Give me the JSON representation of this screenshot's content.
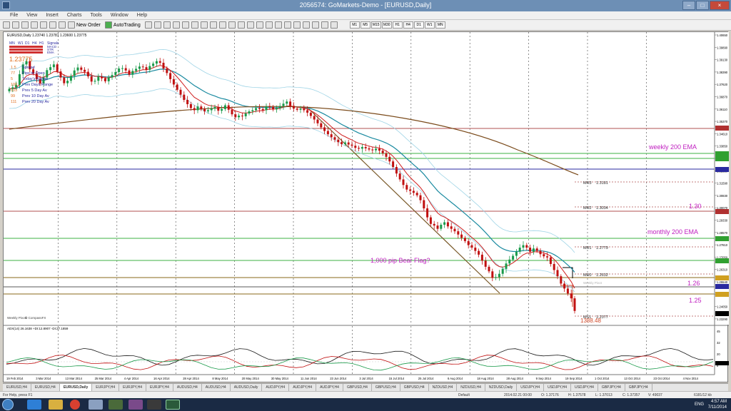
{
  "window": {
    "title": "2056574: GoMarkets-Demo - [EURUSD,Daily]"
  },
  "menu": [
    "File",
    "View",
    "Insert",
    "Charts",
    "Tools",
    "Window",
    "Help"
  ],
  "toolbar": {
    "new_order": "New Order",
    "autotrading": "AutoTrading",
    "timeframes": [
      "M1",
      "M5",
      "M15",
      "M30",
      "H1",
      "H4",
      "D1",
      "W1",
      "MN"
    ]
  },
  "chart_header": "EURUSD,Daily  1.23740 1.23781 1.23600 1.23775",
  "panel": {
    "tf_labels": [
      "MN",
      "W1",
      "D1",
      "H4",
      "H1"
    ],
    "signals_label": "Signals",
    "legend": [
      "MACD",
      "STR",
      "EMA"
    ],
    "price": "1.23775",
    "rows": [
      {
        "val": "1.5",
        "label": "Spread"
      },
      {
        "val": "77",
        "label": "Pips to Open"
      },
      {
        "val": "5",
        "label": "Today's Range"
      },
      {
        "val": "100",
        "label": "Prev Days Range"
      },
      {
        "val": "103",
        "label": "Prev 5 Day Av"
      },
      {
        "val": "99",
        "label": "Prev 10 Day Av"
      },
      {
        "val": "111",
        "label": "Prev 20 Day Av"
      }
    ]
  },
  "annotations": {
    "weekly": "weekly 200 EMA",
    "l130": "1.30",
    "monthly": "monthly 200 EMA",
    "flag": "1,000 pip Bear Flag?",
    "l126": "1.26",
    "l125": "1.25",
    "weekly_pivots": "Weekly Pivots",
    "copyright": "© CompassFX",
    "weekly_pivot_label": "Weekly Pivot"
  },
  "pivots": [
    {
      "name": "MR3",
      "value": "1.3181"
    },
    {
      "name": "MR2",
      "value": "1.3034"
    },
    {
      "name": "MR1",
      "value": "1.2779"
    },
    {
      "name": "MR0",
      "value": "1.2632"
    },
    {
      "name": "MS1",
      "value": "1.2377"
    }
  ],
  "pips_remaining": "1388.48",
  "adx_header": "ADX(14) 26.1638 +DI:12.8907 -DI:27.1859",
  "status": {
    "help": "For Help, press F1",
    "profile": "Default",
    "datetime": "2014.02.21 00:00",
    "open": "O: 1.37176",
    "high": "H: 1.37578",
    "low": "L: 1.37013",
    "close": "C: 1.37357",
    "volume": "V: 49037",
    "traffic": "6181/12 kb"
  },
  "tabs": [
    "EURUSD,H4",
    "EURUSD,H4",
    "EURUSD,Daily",
    "EURJPY,H4",
    "EURJPY,H4",
    "EURJPY,H4",
    "AUDUSD,H4",
    "AUDUSD,H4",
    "AUDUSD,Daily",
    "AUDJPY,H4",
    "AUDJPY,H4",
    "AUDJPY,H4",
    "GBPUSD,H4",
    "GBPUSD,H4",
    "GBPUSD,H4",
    "NZDUSD,H4",
    "NZDUSD,H4",
    "NZDUSD,Daily",
    "USDJPY,H4",
    "USDJPY,H4",
    "USDJPY,H4",
    "GBPJPY,H4",
    "GBPJPY,H4"
  ],
  "clock": {
    "time": "4:57 AM",
    "date": "7/11/2014",
    "lang": "ENG"
  },
  "chart_data": {
    "type": "candlestick",
    "dates": [
      "19 Feb 2014",
      "3 Mar 2014",
      "13 Mar 2014",
      "25 Mar 2014",
      "4 Apr 2014",
      "16 Apr 2014",
      "28 Apr 2014",
      "8 May 2014",
      "20 May 2014",
      "30 May 2014",
      "11 Jun 2014",
      "23 Jun 2014",
      "3 Jul 2014",
      "15 Jul 2014",
      "25 Jul 2014",
      "6 Aug 2014",
      "18 Aug 2014",
      "28 Aug 2014",
      "9 Sep 2014",
      "19 Sep 2014",
      "1 Oct 2014",
      "13 Oct 2014",
      "23 Oct 2014",
      "4 Nov 2014"
    ],
    "y_ticks": [
      "1.40650",
      "1.39890",
      "1.39130",
      "1.38390",
      "1.37620",
      "1.36870",
      "1.36110",
      "1.35370",
      "1.34610",
      "1.33850",
      "1.33100",
      "1.32350",
      "1.31590",
      "1.30830",
      "1.30070",
      "1.29330",
      "1.28570",
      "1.27810",
      "1.27050",
      "1.26310",
      "1.25540",
      "1.24790",
      "1.24050",
      "1.23290"
    ],
    "adx_ticks": [
      "45",
      "32",
      "20",
      "8"
    ],
    "close": [
      1.37357,
      1.3745,
      1.376,
      1.3825,
      1.3885,
      1.3905,
      1.3855,
      1.383,
      1.3795,
      1.3768,
      1.3805,
      1.385,
      1.3868,
      1.3885,
      1.3842,
      1.3805,
      1.377,
      1.3785,
      1.3815,
      1.3848,
      1.3866,
      1.3852,
      1.384,
      1.3812,
      1.378,
      1.3785,
      1.381,
      1.38,
      1.3782,
      1.3805,
      1.382,
      1.3838,
      1.386,
      1.3862,
      1.3848,
      1.3822,
      1.3845,
      1.3858,
      1.3872,
      1.3868,
      1.3852,
      1.3875,
      1.389,
      1.3905,
      1.3895,
      1.386,
      1.3832,
      1.3795,
      1.3762,
      1.373,
      1.37,
      1.3668,
      1.3642,
      1.3618,
      1.3605,
      1.3628,
      1.3612,
      1.3598,
      1.3605,
      1.3615,
      1.3625,
      1.3602,
      1.3612,
      1.3635,
      1.3608,
      1.358,
      1.3562,
      1.3572,
      1.3568,
      1.3585,
      1.3598,
      1.3605,
      1.3618,
      1.3612,
      1.3605,
      1.3628,
      1.3625,
      1.361,
      1.3618,
      1.363,
      1.3645,
      1.3658,
      1.3632,
      1.3615,
      1.3608,
      1.3615,
      1.3605,
      1.359,
      1.357,
      1.3548,
      1.3525,
      1.35,
      1.3478,
      1.3458,
      1.344,
      1.3425,
      1.341,
      1.3398,
      1.3408,
      1.3395,
      1.3388,
      1.3375,
      1.337,
      1.338,
      1.3372,
      1.3365,
      1.336,
      1.337,
      1.3358,
      1.3342,
      1.332,
      1.3292,
      1.3258,
      1.3218,
      1.3182,
      1.3148,
      1.312,
      1.3112,
      1.31,
      1.3085,
      1.3055,
      1.3005,
      1.295,
      1.291,
      1.29,
      1.288,
      1.2905,
      1.292,
      1.2895,
      1.288,
      1.2865,
      1.2845,
      1.2825,
      1.2805,
      1.278,
      1.2765,
      1.2745,
      1.2722,
      1.2685,
      1.2648,
      1.262,
      1.258,
      1.2585,
      1.2605,
      1.2635,
      1.2668,
      1.2692,
      1.2715,
      1.274,
      1.2765,
      1.278,
      1.2765,
      1.274,
      1.276,
      1.2745,
      1.2725,
      1.2712,
      1.2705,
      1.2665,
      1.2628,
      1.259,
      1.2545,
      1.2515,
      1.2485,
      1.2455,
      1.2378
    ]
  }
}
